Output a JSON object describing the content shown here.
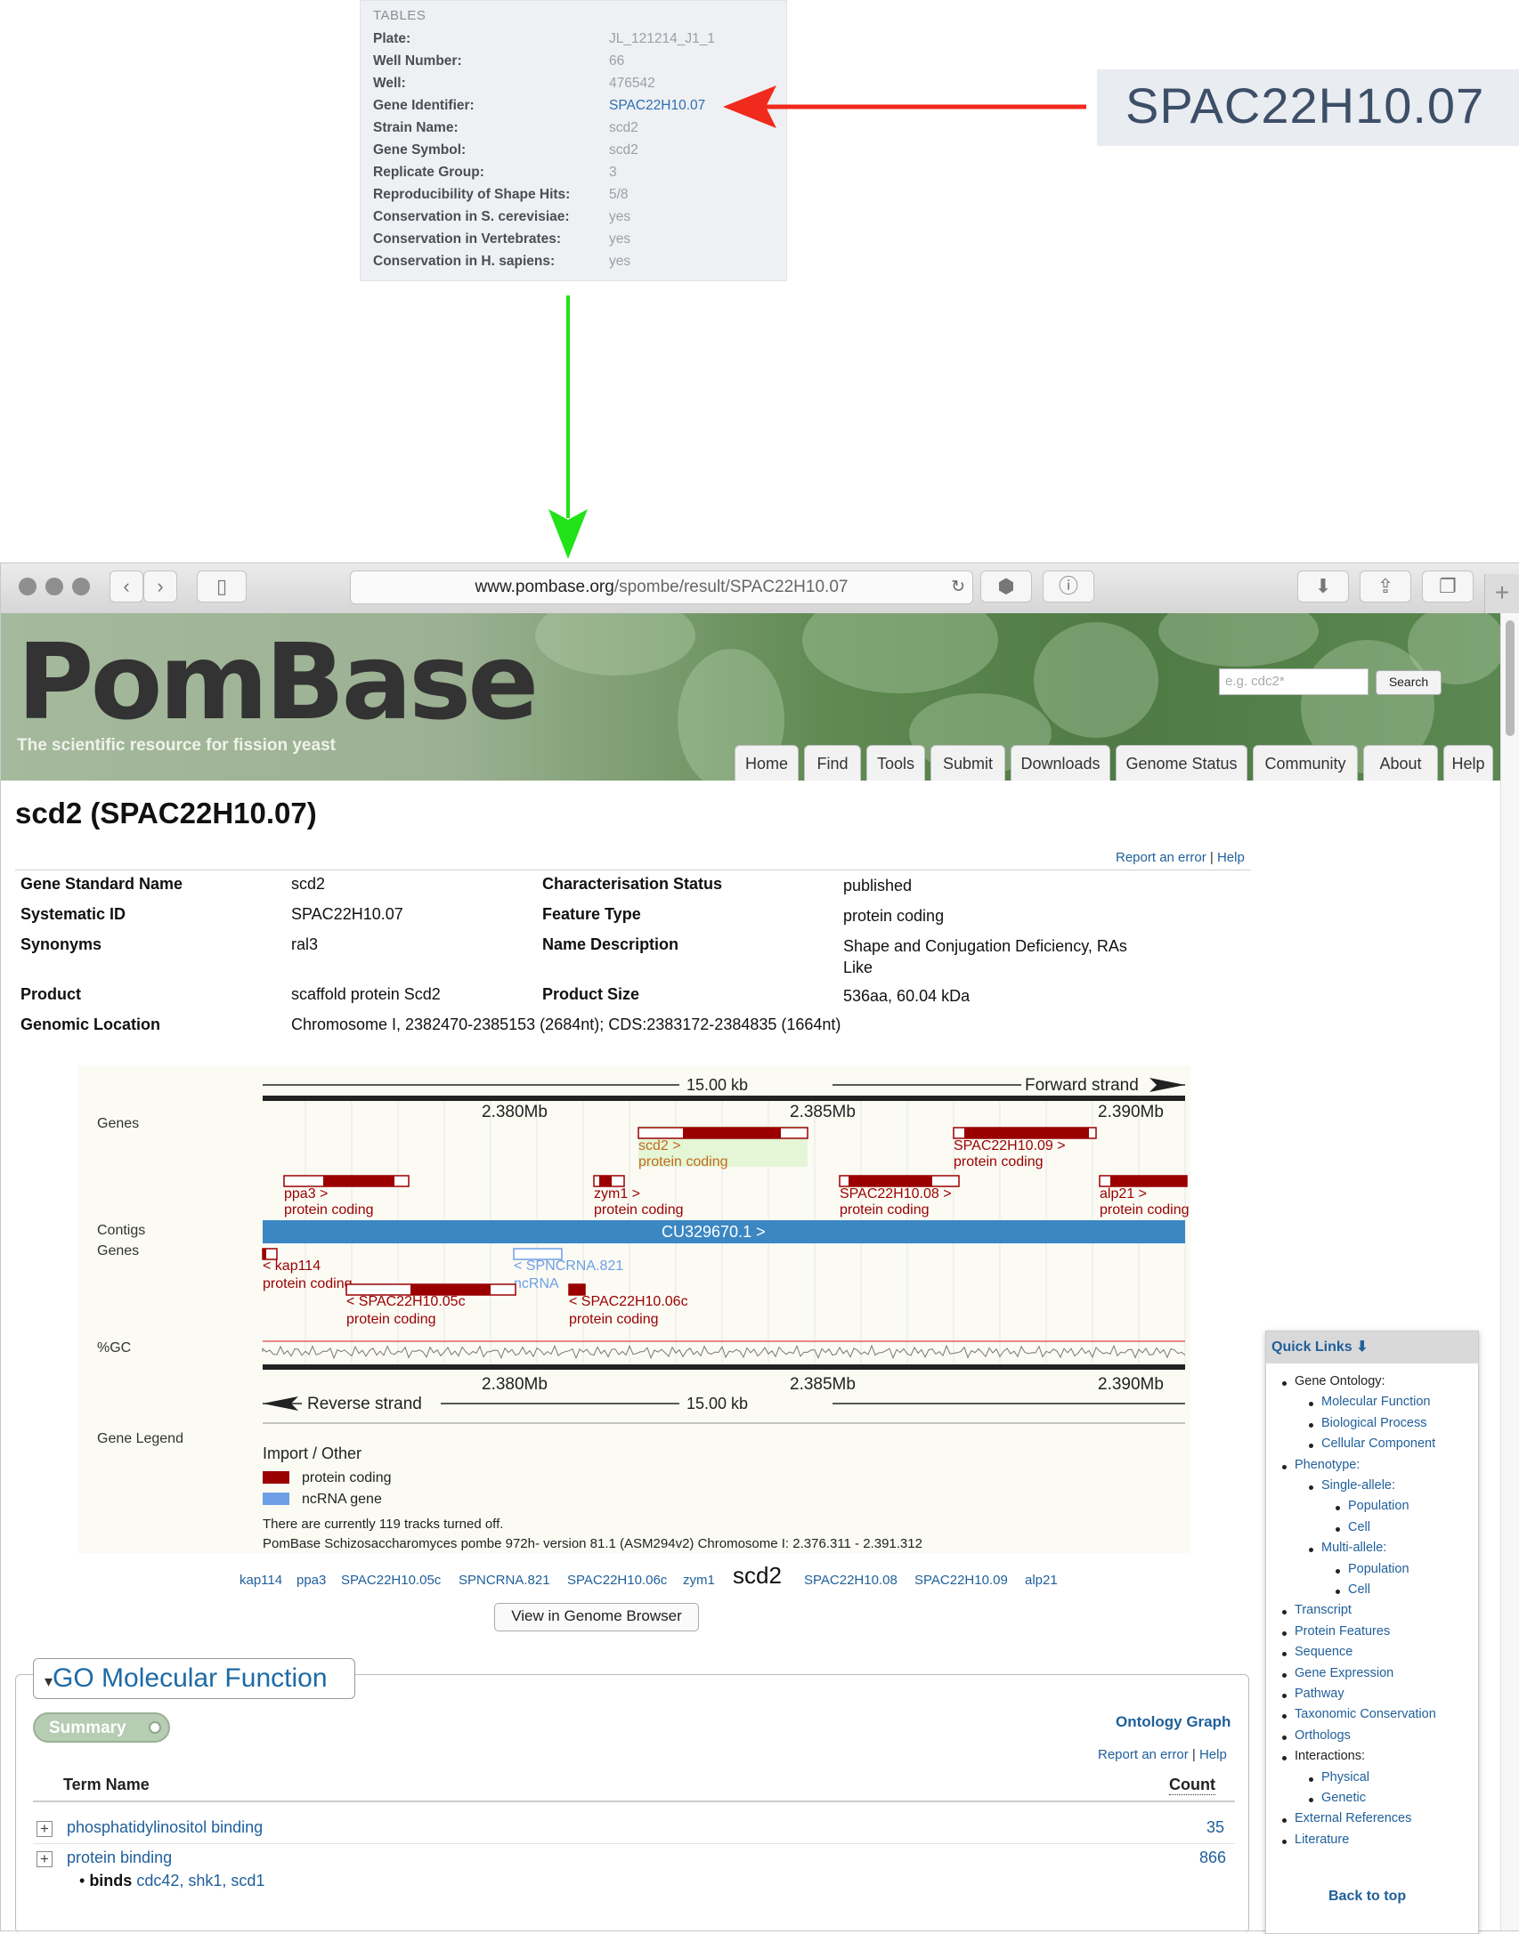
{
  "tables_panel": {
    "title": "TABLES",
    "rows": [
      {
        "key": "Plate:",
        "value": "JL_121214_J1_1"
      },
      {
        "key": "Well Number:",
        "value": "66"
      },
      {
        "key": "Well:",
        "value": "476542"
      },
      {
        "key": "Gene Identifier:",
        "value": "SPAC22H10.07"
      },
      {
        "key": "Strain Name:",
        "value": "scd2"
      },
      {
        "key": "Gene Symbol:",
        "value": "scd2"
      },
      {
        "key": "Replicate Group:",
        "value": "3"
      },
      {
        "key": "Reproducibility of Shape Hits:",
        "value": "5/8"
      },
      {
        "key": "Conservation in S. cerevisiae:",
        "value": "yes"
      },
      {
        "key": "Conservation in Vertebrates:",
        "value": "yes"
      },
      {
        "key": "Conservation in H. sapiens:",
        "value": "yes"
      }
    ]
  },
  "zoom_callout": {
    "text": "SPAC22H10.07"
  },
  "arrows": {
    "red": "#f02a1c",
    "green": "#22e21a"
  },
  "browser": {
    "url_domain": "www.pombase.org",
    "url_path": "/spombe/result/SPAC22H10.07"
  },
  "header": {
    "logo": "PomBase",
    "tagline": "The scientific resource for fission yeast",
    "search_placeholder": "e.g. cdc2*",
    "search_button": "Search",
    "nav": [
      "Home",
      "Find",
      "Tools",
      "Submit",
      "Downloads",
      "Genome Status",
      "Community",
      "About",
      "Help"
    ]
  },
  "page": {
    "title": "scd2 (SPAC22H10.07)",
    "report_error": "Report an error",
    "help": "Help",
    "separator": "|"
  },
  "gene_info": {
    "left": [
      {
        "key": "Gene Standard Name",
        "value": "scd2"
      },
      {
        "key": "Systematic ID",
        "value": "SPAC22H10.07"
      },
      {
        "key": "Synonyms",
        "value": "ral3"
      },
      {
        "key": "Product",
        "value": "scaffold protein Scd2"
      },
      {
        "key": "Genomic Location",
        "value": "Chromosome I, 2382470-2385153 (2684nt); CDS:2383172-2384835 (1664nt)"
      }
    ],
    "right": [
      {
        "key": "Characterisation Status",
        "value": "published"
      },
      {
        "key": "Feature Type",
        "value": "protein coding"
      },
      {
        "key": "Name Description",
        "value": "Shape and Conjugation Deficiency, RAs Like"
      },
      {
        "key": "Product Size",
        "value": "536aa, 60.04 kDa"
      }
    ]
  },
  "genome_view": {
    "scale_label": "15.00 kb",
    "forward": "Forward strand",
    "reverse": "Reverse strand",
    "ticks": [
      "2.380Mb",
      "2.385Mb",
      "2.390Mb"
    ],
    "track_labels": {
      "genes": "Genes",
      "contigs": "Contigs",
      "genes2": "Genes",
      "gc": "%GC",
      "legend": "Gene Legend"
    },
    "contig": "CU329670.1 >",
    "fwd_genes": [
      {
        "name": "scd2 >",
        "type": "protein coding"
      },
      {
        "name": "SPAC22H10.09 >",
        "type": "protein coding"
      },
      {
        "name": "ppa3 >",
        "type": "protein coding"
      },
      {
        "name": "zym1 >",
        "type": "protein coding"
      },
      {
        "name": "SPAC22H10.08 >",
        "type": "protein coding"
      },
      {
        "name": "alp21 >",
        "type": "protein coding"
      }
    ],
    "rev_genes": [
      {
        "name": "< kap114",
        "type": "protein coding"
      },
      {
        "name": "< SPNCRNA.821",
        "type": "ncRNA"
      },
      {
        "name": "< SPAC22H10.05c",
        "type": "protein coding"
      },
      {
        "name": "< SPAC22H10.06c",
        "type": "protein coding"
      }
    ],
    "legend_title": "Import / Other",
    "legend_items": [
      {
        "label": "protein coding",
        "color": "#9a0000"
      },
      {
        "label": "ncRNA gene",
        "color": "#6e9fe6"
      }
    ],
    "tracks_off": "There are currently 119 tracks turned off.",
    "assembly": "PomBase Schizosaccharomyces pombe 972h- version 81.1 (ASM294v2) Chromosome I: 2.376.311 - 2.391.312"
  },
  "gene_links": [
    "kap114",
    "ppa3",
    "SPAC22H10.05c",
    "SPNCRNA.821",
    "SPAC22H10.06c",
    "zym1",
    "scd2",
    "SPAC22H10.08",
    "SPAC22H10.09",
    "alp21"
  ],
  "view_button": "View in Genome Browser",
  "go_section": {
    "title": "GO Molecular Function",
    "summary": "Summary",
    "ontology_graph": "Ontology Graph",
    "term_header": "Term Name",
    "count_header": "Count",
    "terms": [
      {
        "name": "phosphatidylinositol binding",
        "count": "35"
      },
      {
        "name": "protein binding",
        "count": "866"
      }
    ],
    "binds_label": "binds",
    "binds_targets": "cdc42, shk1, scd1"
  },
  "quick_links": {
    "title": "Quick Links",
    "items": [
      {
        "label": "Gene Ontology:",
        "level": 0,
        "dark": true
      },
      {
        "label": "Molecular Function",
        "level": 1
      },
      {
        "label": "Biological Process",
        "level": 1
      },
      {
        "label": "Cellular Component",
        "level": 1
      },
      {
        "label": "Phenotype:",
        "level": 0
      },
      {
        "label": "Single-allele:",
        "level": 1
      },
      {
        "label": "Population",
        "level": 2
      },
      {
        "label": "Cell",
        "level": 2
      },
      {
        "label": "Multi-allele:",
        "level": 1
      },
      {
        "label": "Population",
        "level": 2
      },
      {
        "label": "Cell",
        "level": 2
      },
      {
        "label": "Transcript",
        "level": 0
      },
      {
        "label": "Protein Features",
        "level": 0
      },
      {
        "label": "Sequence",
        "level": 0
      },
      {
        "label": "Gene Expression",
        "level": 0
      },
      {
        "label": "Pathway",
        "level": 0
      },
      {
        "label": "Taxonomic Conservation",
        "level": 0
      },
      {
        "label": "Orthologs",
        "level": 0
      },
      {
        "label": "Interactions:",
        "level": 0,
        "dark": true
      },
      {
        "label": "Physical",
        "level": 1
      },
      {
        "label": "Genetic",
        "level": 1
      },
      {
        "label": "External References",
        "level": 0
      },
      {
        "label": "Literature",
        "level": 0
      }
    ],
    "back_to_top": "Back to top"
  }
}
